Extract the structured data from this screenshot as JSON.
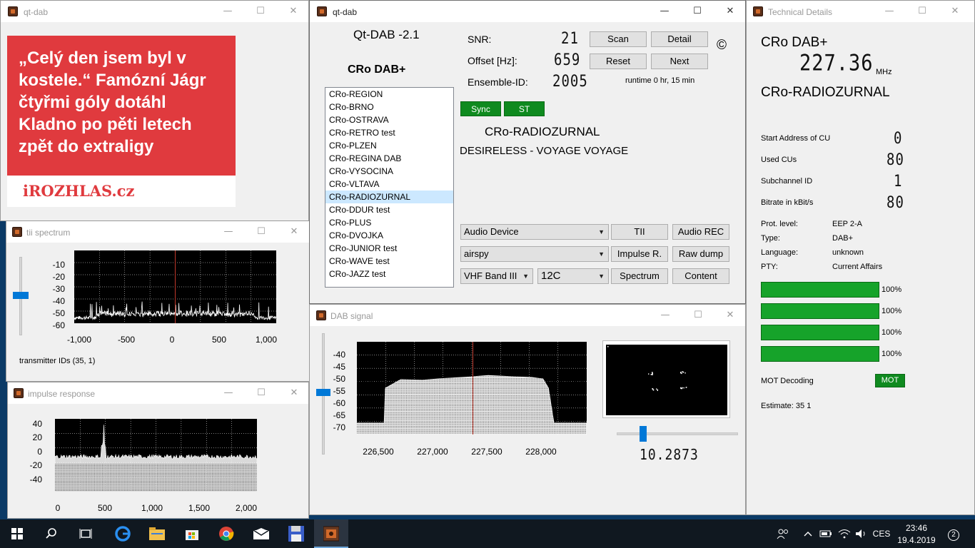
{
  "news": {
    "headline": "„Celý den jsem byl v kostele.“ Famózní Jágr čtyřmi góly dotáhl Kladno po pěti letech zpět do extraligy",
    "brand": "iROZHLAS.cz",
    "window_title": "qt-dab"
  },
  "main": {
    "window_title": "qt-dab",
    "app_title": "Qt-DAB -2.1",
    "ensemble_name": "CRo DAB+",
    "snr_label": "SNR:",
    "snr_value": "21",
    "offset_label": "Offset [Hz]:",
    "offset_value": "659",
    "ensemble_id_label": "Ensemble-ID:",
    "ensemble_id_value": "2005",
    "runtime": "runtime 0 hr, 15 min",
    "copyright": "©",
    "buttons": {
      "scan": "Scan",
      "detail": "Detail",
      "reset": "Reset",
      "next": "Next",
      "tii": "TII",
      "audio_rec": "Audio REC",
      "impulse": "Impulse R.",
      "raw_dump": "Raw dump",
      "spectrum": "Spectrum",
      "content": "Content"
    },
    "sync": "Sync",
    "st": "ST",
    "current_service": "CRo-RADIOZURNAL",
    "dynamic_label": "DESIRELESS - VOYAGE VOYAGE",
    "audio_device": "Audio Device",
    "input_device": "airspy",
    "band": "VHF Band III",
    "channel": "12C",
    "services": [
      "CRo-REGION",
      "CRo-BRNO",
      "CRo-OSTRAVA",
      "CRo-RETRO test",
      "CRo-PLZEN",
      "CRo-REGINA DAB",
      "CRo-VYSOCINA",
      "CRo-VLTAVA",
      "CRo-RADIOZURNAL",
      "CRo-DDUR test",
      "CRo-PLUS",
      "CRo-DVOJKA",
      "CRo-JUNIOR test",
      "CRo-WAVE test",
      "CRo-JAZZ test"
    ],
    "selected_index": 8
  },
  "tech": {
    "window_title": "Technical Details",
    "ensemble": "CRo DAB+",
    "frequency": "227.36",
    "freq_unit": "MHz",
    "service": "CRo-RADIOZURNAL",
    "start_address_label": "Start Address of CU",
    "start_address": "0",
    "used_cus_label": "Used CUs",
    "used_cus": "80",
    "subchannel_label": "Subchannel ID",
    "subchannel": "1",
    "bitrate_label": "Bitrate in kBit/s",
    "bitrate": "80",
    "prot_label": "Prot. level:",
    "prot": "EEP 2-A",
    "type_label": "Type:",
    "type": "DAB+",
    "language_label": "Language:",
    "language": "unknown",
    "pty_label": "PTY:",
    "pty": "Current Affairs",
    "quality": [
      100,
      100,
      100,
      100
    ],
    "quality_text": [
      "100%",
      "100%",
      "100%",
      "100%"
    ],
    "mot_label": "MOT Decoding",
    "mot": "MOT",
    "estimate": "Estimate: 35  1"
  },
  "tii": {
    "window_title": "tii spectrum",
    "transmitter": "transmitter IDs  (35, 1)"
  },
  "impulse": {
    "window_title": "impulse response"
  },
  "signal": {
    "window_title": "DAB signal",
    "readout": "10.2873"
  },
  "chart_data": [
    {
      "type": "line",
      "name": "tii spectrum",
      "xlim": [
        -1000,
        1000
      ],
      "ylim": [
        -65,
        -5
      ],
      "xticks": [
        "-1,000",
        "-500",
        "0",
        "500",
        "1,000"
      ],
      "yticks": [
        "-10",
        "-20",
        "-30",
        "-40",
        "-50",
        "-60"
      ],
      "grid": true
    },
    {
      "type": "line",
      "name": "impulse response",
      "xlim": [
        0,
        2048
      ],
      "ylim": [
        -50,
        50
      ],
      "xticks": [
        "0",
        "500",
        "1,000",
        "1,500",
        "2,000"
      ],
      "yticks": [
        "40",
        "20",
        "0",
        "-20",
        "-40"
      ],
      "grid": true
    },
    {
      "type": "area",
      "name": "DAB signal",
      "xlim": [
        226300,
        228400
      ],
      "ylim": [
        -75,
        -35
      ],
      "xticks": [
        "226,500",
        "227,000",
        "227,500",
        "228,000"
      ],
      "yticks": [
        "-40",
        "-45",
        "-50",
        "-55",
        "-60",
        "-65",
        "-70"
      ],
      "x": [
        226300,
        226550,
        226560,
        226700,
        226900,
        227100,
        227300,
        227500,
        227700,
        227900,
        228000,
        228050,
        228100,
        228400
      ],
      "y": [
        -70,
        -70,
        -55,
        -52,
        -51,
        -50.5,
        -50,
        -50,
        -50,
        -50.5,
        -51,
        -55,
        -70,
        -70
      ],
      "grid": true
    }
  ],
  "taskbar": {
    "lang": "CES",
    "time": "23:46",
    "date": "19.4.2019",
    "notifications": "2"
  }
}
